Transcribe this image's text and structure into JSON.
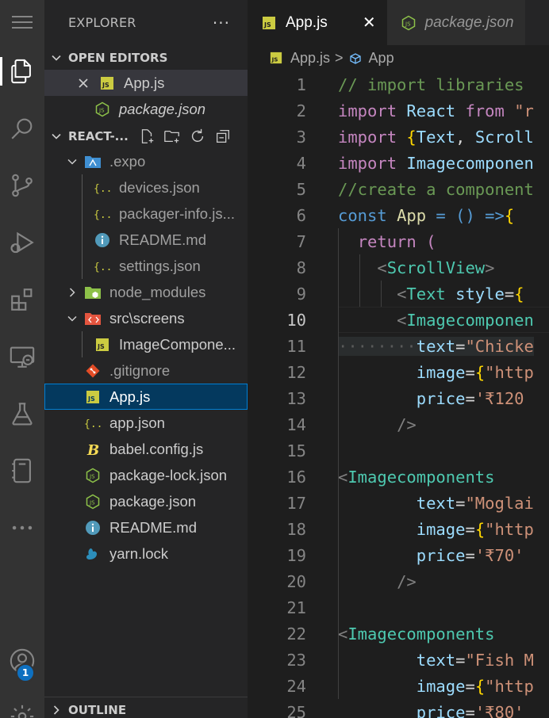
{
  "colors": {
    "accent": "#007fd4",
    "js_icon": "#cbcb41",
    "json_icon": "#8dc149",
    "info_icon": "#519aba",
    "git_icon": "#e34c26"
  },
  "activity_bar": {
    "icons": [
      "explorer-icon",
      "search-icon",
      "source-control-icon",
      "run-debug-icon",
      "extensions-icon",
      "remote-explorer-icon",
      "testing-icon",
      "bookmarks-icon",
      "more-icon",
      "account-icon",
      "settings-icon"
    ],
    "badge": "1"
  },
  "sidebar": {
    "title": "EXPLORER",
    "more": "···",
    "open_editors": {
      "label": "OPEN EDITORS",
      "items": [
        {
          "name": "App.js",
          "icon": "js"
        },
        {
          "name": "package.json",
          "icon": "json"
        }
      ]
    },
    "project": {
      "label": "REACT-...",
      "tree": [
        {
          "name": ".expo",
          "icon": "folder-expo"
        },
        {
          "name": "devices.json",
          "icon": "json-braces"
        },
        {
          "name": "packager-info.js...",
          "icon": "json-braces"
        },
        {
          "name": "README.md",
          "icon": "info"
        },
        {
          "name": "settings.json",
          "icon": "json-braces"
        },
        {
          "name": "node_modules",
          "icon": "folder-node"
        },
        {
          "name": "src\\screens",
          "icon": "folder-src"
        },
        {
          "name": "ImageCompone...",
          "icon": "js"
        },
        {
          "name": ".gitignore",
          "icon": "git"
        },
        {
          "name": "App.js",
          "icon": "js"
        },
        {
          "name": "app.json",
          "icon": "json-braces"
        },
        {
          "name": "babel.config.js",
          "icon": "babel"
        },
        {
          "name": "package-lock.json",
          "icon": "json"
        },
        {
          "name": "package.json",
          "icon": "json"
        },
        {
          "name": "README.md",
          "icon": "info"
        },
        {
          "name": "yarn.lock",
          "icon": "yarn"
        }
      ]
    },
    "outline": {
      "label": "OUTLINE"
    }
  },
  "editor": {
    "tabs": [
      {
        "name": "App.js",
        "active": true
      },
      {
        "name": "package.json",
        "active": false
      }
    ],
    "close": "✕",
    "breadcrumb": {
      "file": "App.js",
      "sep": ">",
      "symbol": "App"
    },
    "current_line": 10,
    "lines": [
      {
        "n": "1"
      },
      {
        "n": "2"
      },
      {
        "n": "3"
      },
      {
        "n": "4"
      },
      {
        "n": "5"
      },
      {
        "n": "6"
      },
      {
        "n": "7"
      },
      {
        "n": "8"
      },
      {
        "n": "9"
      },
      {
        "n": "10"
      },
      {
        "n": "11"
      },
      {
        "n": "12"
      },
      {
        "n": "13"
      },
      {
        "n": "14"
      },
      {
        "n": "15"
      },
      {
        "n": "16"
      },
      {
        "n": "17"
      },
      {
        "n": "18"
      },
      {
        "n": "19"
      },
      {
        "n": "20"
      },
      {
        "n": "21"
      },
      {
        "n": "22"
      },
      {
        "n": "23"
      },
      {
        "n": "24"
      },
      {
        "n": "25"
      }
    ],
    "code": {
      "l1": "// import libraries",
      "l2a": "import",
      "l2b": "React",
      "l2c": "from",
      "l2d": "\"r",
      "l3a": "import",
      "l3b": "{",
      "l3c": "Text",
      "l3d": ", ",
      "l3e": "Scroll",
      "l4a": "import",
      "l4b": "Imagecomponen",
      "l5": "//create a component",
      "l6a": "const",
      "l6b": "App",
      "l6c": " = () =>",
      "l6d": "{",
      "l7a": "return",
      "l7b": "(",
      "l8a": "<",
      "l8b": "ScrollView",
      "l8c": ">",
      "l9a": "<",
      "l9b": "Text",
      "l9c": "style",
      "l9d": "=",
      "l9e": "{",
      "l10a": "<",
      "l10b": "Imagecomponen",
      "l11a": "text",
      "l11b": "=",
      "l11c": "\"Chicke",
      "l12a": "image",
      "l12b": "=",
      "l12c": "{",
      "l12d": "\"http",
      "l13a": "price",
      "l13b": "=",
      "l13c": "'₹120",
      "l14": "/>",
      "l16a": "<",
      "l16b": "Imagecomponents",
      "l17a": "text",
      "l17b": "=",
      "l17c": "\"Moglai",
      "l18a": "image",
      "l18b": "=",
      "l18c": "{",
      "l18d": "\"http",
      "l19a": "price",
      "l19b": "=",
      "l19c": "'₹70'",
      "l20": "/>",
      "l22a": "<",
      "l22b": "Imagecomponents",
      "l23a": "text",
      "l23b": "=",
      "l23c": "\"Fish M",
      "l24a": "image",
      "l24b": "=",
      "l24c": "{",
      "l24d": "\"http",
      "l25a": "price",
      "l25b": "=",
      "l25c": "'₹80'"
    }
  }
}
